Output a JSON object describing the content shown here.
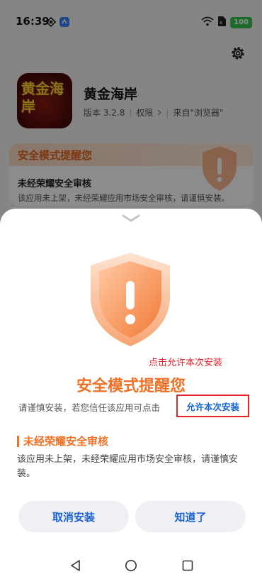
{
  "status_bar": {
    "time": "16:39",
    "battery": "100",
    "icons": [
      "nfc-icon",
      "app-badge-icon",
      "wifi-icon",
      "sim-icon",
      "battery-icon"
    ]
  },
  "app": {
    "name": "黄金海岸",
    "logo_text": "黄金海岸",
    "version": "版本 3.2.8",
    "permissions": "权限",
    "source": "来自\"浏览器\""
  },
  "background_card": {
    "title": "安全模式提醒您",
    "subtitle": "未经荣耀安全审核",
    "description": "该应用未上架，未经荣耀应用市场安全审核，请谨慎安装。"
  },
  "sheet": {
    "annotation": "点击允许本次安装",
    "title": "安全模式提醒您",
    "description": "请谨慎安装，若您信任该应用可点击",
    "allow_link": "允许本次安装",
    "section_title": "未经荣耀安全审核",
    "section_description": "该应用未上架，未经荣耀应用市场安全审核，请谨慎安装。",
    "cancel_button": "取消安装",
    "ok_button": "知道了"
  },
  "colors": {
    "accent_orange": "#f07026",
    "link_blue": "#1565d8",
    "highlight_red": "#e3232b"
  }
}
